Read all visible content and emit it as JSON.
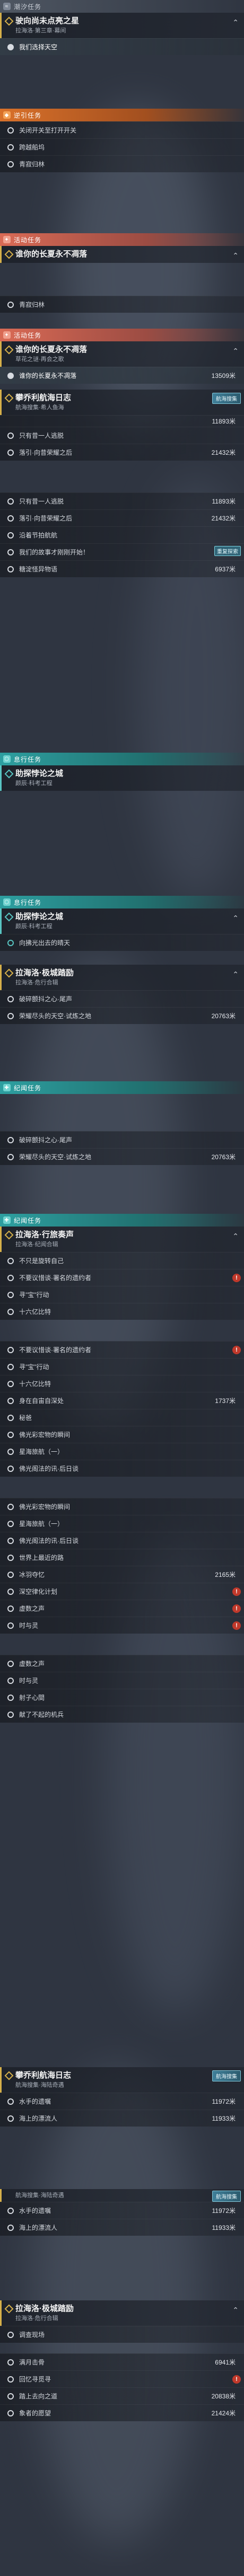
{
  "tracker": {
    "seg1": {
      "category": "潮汐任务",
      "quest_title": "驶向尚未点亮之星",
      "quest_sub": "拉海洛·第三章·幕间",
      "steps": [
        {
          "text": "我们选择天空",
          "dist": ""
        }
      ]
    },
    "seg2": {
      "category": "逆引任务",
      "steps": [
        {
          "text": "关闭开关至打开开关",
          "dist": ""
        },
        {
          "text": "跨越船坞",
          "dist": ""
        },
        {
          "text": "青寂归林",
          "dist": ""
        }
      ]
    },
    "seg3": {
      "category": "活动任务",
      "quest_title": "谁你的长夏永不凋落",
      "steps": [
        {
          "text": "青寂归林",
          "dist": ""
        }
      ]
    },
    "seg4": {
      "category": "活动任务",
      "quest_title": "谁你的长夏永不凋落",
      "quest_sub": "草花之谜·再会之歌",
      "steps": [
        {
          "text": "谁你的长夏永不凋落",
          "dist": "13509米"
        }
      ]
    },
    "seg5": {
      "quest_title": "攀乔利航海日志",
      "quest_sub": "航海搜集·希人鱼海",
      "ship_tag": "航海搜集",
      "dist_top": "11893米",
      "steps": [
        {
          "text": "只有昔一人逃脱",
          "dist": ""
        },
        {
          "text": "落引·向昔荣耀之后",
          "dist": "21432米"
        },
        {
          "text": "只有昔一人逃脱",
          "dist": "11893米"
        },
        {
          "text": "落引·向昔荣耀之后",
          "dist": "21432米"
        },
        {
          "text": "沿着节拍航航",
          "dist": ""
        },
        {
          "text": "我们的故事才刚刚开始！",
          "dist": "",
          "tag": "重复探索"
        },
        {
          "text": "糖淀怪异物语",
          "dist": "6937米"
        }
      ]
    },
    "seg6": {
      "category": "息行任务",
      "quest_title": "助探悖论之城",
      "quest_sub": "颜辰·科考工程",
      "steps": []
    },
    "seg7": {
      "category": "息行任务",
      "quest_title": "助探悖论之城",
      "quest_sub": "颜辰·科考工程",
      "steps": [
        {
          "text": "向拂光出去的晴天",
          "dist": ""
        }
      ]
    },
    "seg8": {
      "quest_title": "拉海洛·极城踏励",
      "quest_sub": "拉海洛·危行合辑",
      "steps": [
        {
          "text": "破碎颤抖之心·尾声",
          "dist": ""
        },
        {
          "text": "荣耀尽头的天空·试炼之地",
          "dist": "20763米"
        }
      ]
    },
    "seg9": {
      "category": "纪闻任务",
      "steps": [
        {
          "text": "破碎颤抖之心·尾声",
          "dist": ""
        },
        {
          "text": "荣耀尽头的天空·试炼之地",
          "dist": "20763米"
        }
      ]
    },
    "seg10": {
      "category": "纪闻任务",
      "quest_title": "拉海洛·行旅奏声",
      "quest_sub": "拉海洛·纪闻合辑",
      "steps": [
        {
          "text": "不只是旋转自己",
          "dist": ""
        },
        {
          "text": "不要议惜谈·署名的遗约者",
          "dist": ""
        },
        {
          "text": "寻\"宝\"行动",
          "dist": ""
        },
        {
          "text": "十六亿比特",
          "dist": ""
        },
        {
          "text": "不要议惜谈·署名的遗约者",
          "dist": ""
        },
        {
          "text": "寻\"宝\"行动",
          "dist": ""
        },
        {
          "text": "十六亿比特",
          "dist": ""
        },
        {
          "text": "身在自宙自深处",
          "dist": "1737米"
        },
        {
          "text": "秘爸",
          "dist": ""
        },
        {
          "text": "佛光彩宏物的瞬间",
          "dist": ""
        },
        {
          "text": "星海旅航（一）",
          "dist": ""
        },
        {
          "text": "佛光阁法的讯·后日谈",
          "dist": ""
        },
        {
          "text": "佛光彩宏物的瞬间",
          "dist": ""
        },
        {
          "text": "星海旅航（一）",
          "dist": ""
        },
        {
          "text": "佛光阁法的讯·后日谈",
          "dist": ""
        },
        {
          "text": "世界上最近的路",
          "dist": ""
        },
        {
          "text": "冰羽夺忆",
          "dist": "2165米"
        },
        {
          "text": "深空律化计划",
          "dist": ""
        },
        {
          "text": "虚数之声",
          "dist": ""
        },
        {
          "text": "时与灵",
          "dist": ""
        },
        {
          "text": "虚数之声",
          "dist": ""
        },
        {
          "text": "时与灵",
          "dist": ""
        },
        {
          "text": "射子心間",
          "dist": ""
        },
        {
          "text": "献了不起的机兵",
          "dist": ""
        }
      ]
    },
    "seg11": {
      "quest_title": "攀乔利航海日志",
      "quest_sub": "航海搜集·海陆奇遇",
      "ship_tag": "航海搜集",
      "steps": [
        {
          "text": "水手的遗嘱",
          "dist": "11972米"
        },
        {
          "text": "海上的漂流人",
          "dist": "11933米"
        }
      ]
    },
    "seg12": {
      "category": "航海搜集·海陆奇遇",
      "ship_tag": "航海搜集",
      "steps": [
        {
          "text": "水手的遗嘱",
          "dist": "11972米"
        },
        {
          "text": "海上的漂流人",
          "dist": "11933米"
        }
      ]
    },
    "seg13": {
      "quest_title": "拉海洛·极城踏励",
      "quest_sub": "拉海洛·危行合辑",
      "steps": [
        {
          "text": "调查现场",
          "dist": ""
        },
        {
          "text": "满月击骨",
          "dist": "6941米"
        },
        {
          "text": "回忆寻觅寻",
          "dist": ""
        },
        {
          "text": "踏上去向之道",
          "dist": "20838米"
        },
        {
          "text": "象者的愿望",
          "dist": "21424米"
        }
      ]
    }
  }
}
